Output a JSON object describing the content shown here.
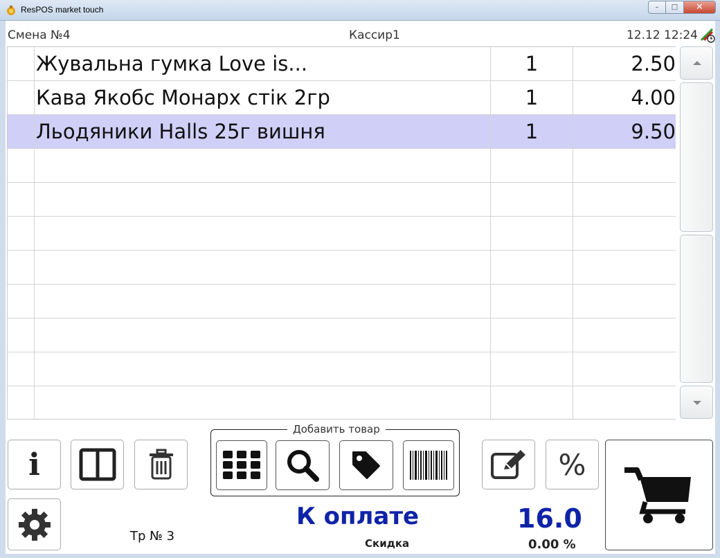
{
  "window": {
    "title": "ResPOS market touch",
    "minimize": "–",
    "maximize": "□",
    "close": "✕"
  },
  "header": {
    "shift": "Смена №4",
    "cashier": "Кассир1",
    "datetime": "12.12 12:24"
  },
  "order": {
    "rows": [
      {
        "name": "Жувальна гумка Love is...",
        "qty": "1",
        "price": "2.50",
        "selected": false
      },
      {
        "name": "Кава Якобс Монарх стік 2гр",
        "qty": "1",
        "price": "4.00",
        "selected": false
      },
      {
        "name": "Льодяники Halls 25г вишня",
        "qty": "1",
        "price": "9.50",
        "selected": true
      },
      {
        "name": "",
        "qty": "",
        "price": "",
        "selected": false
      },
      {
        "name": "",
        "qty": "",
        "price": "",
        "selected": false
      },
      {
        "name": "",
        "qty": "",
        "price": "",
        "selected": false
      },
      {
        "name": "",
        "qty": "",
        "price": "",
        "selected": false
      },
      {
        "name": "",
        "qty": "",
        "price": "",
        "selected": false
      },
      {
        "name": "",
        "qty": "",
        "price": "",
        "selected": false
      },
      {
        "name": "",
        "qty": "",
        "price": "",
        "selected": false
      },
      {
        "name": "",
        "qty": "",
        "price": "",
        "selected": false
      }
    ]
  },
  "toolbar": {
    "info_symbol": "i",
    "percent_symbol": "%",
    "add_group_label": "Добавить товар"
  },
  "footer": {
    "transaction": "Тр № 3",
    "pay_label": "К оплате",
    "total": "16.0",
    "discount_label": "Скидка",
    "discount_value": "0.00 %"
  },
  "icons": {
    "info": "info-icon",
    "split": "split-view-icon",
    "delete": "trash-icon",
    "catalog": "grid-icon",
    "search": "search-icon",
    "tag": "price-tag-icon",
    "barcode": "barcode-icon",
    "edit": "edit-icon",
    "discount": "percent-icon",
    "settings": "gear-icon",
    "pay": "cart-icon"
  },
  "colors": {
    "selected_row": "#cfcff8",
    "total_text": "#0f23a8"
  }
}
